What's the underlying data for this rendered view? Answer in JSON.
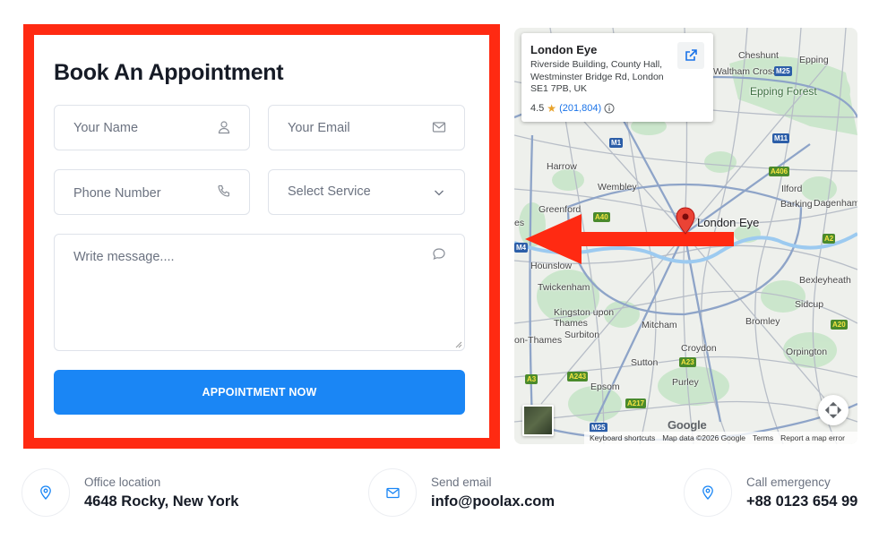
{
  "form": {
    "title": "Book An Appointment",
    "name_placeholder": "Your Name",
    "email_placeholder": "Your Email",
    "phone_placeholder": "Phone Number",
    "service_selected": "Select Service",
    "message_placeholder": "Write message....",
    "submit_label": "APPOINTMENT NOW",
    "accent_color": "#1a86f5",
    "highlight_color": "#ff2a12"
  },
  "map": {
    "place": {
      "name": "London Eye",
      "address": "Riverside Building, County Hall, Westminster Bridge Rd, London SE1 7PB, UK",
      "rating": "4.5",
      "reviews": "(201,804)"
    },
    "pin_label": "London Eye",
    "labels": {
      "cheshunt": "Cheshunt",
      "epping": "Epping",
      "waltham": "Waltham Cross",
      "epping_forest": "Epping Forest",
      "harrow": "Harrow",
      "wembley": "Wembley",
      "ilford": "Ilford",
      "barking": "Barking",
      "dagenham": "Dagenham",
      "greenford": "Greenford",
      "hounslow": "Hounslow",
      "bexleyheath": "Bexleyheath",
      "twickenham": "Twickenham",
      "sidcup": "Sidcup",
      "kingston": "Kingston upon Thames",
      "mitcham": "Mitcham",
      "bromley": "Bromley",
      "surbiton": "Surbiton",
      "thames": "on-Thames",
      "croydon": "Croydon",
      "orpington": "Orpington",
      "sutton": "Sutton",
      "epsom": "Epsom",
      "purley": "Purley",
      "es": "es"
    },
    "roads": [
      "M25",
      "M11",
      "M1",
      "A406",
      "A40",
      "A20",
      "A3",
      "A243",
      "A23",
      "A217",
      "A2",
      "M4"
    ],
    "google": "Google",
    "footer": {
      "shortcuts": "Keyboard shortcuts",
      "mapdata": "Map data ©2026 Google",
      "terms": "Terms",
      "report": "Report a map error"
    }
  },
  "contact": [
    {
      "label": "Office location",
      "value": "4648 Rocky, New York",
      "icon": "location-pin-icon"
    },
    {
      "label": "Send email",
      "value": "info@poolax.com",
      "icon": "envelope-icon"
    },
    {
      "label": "Call emergency",
      "value": "+88 0123 654 99",
      "icon": "location-pin-icon"
    }
  ]
}
